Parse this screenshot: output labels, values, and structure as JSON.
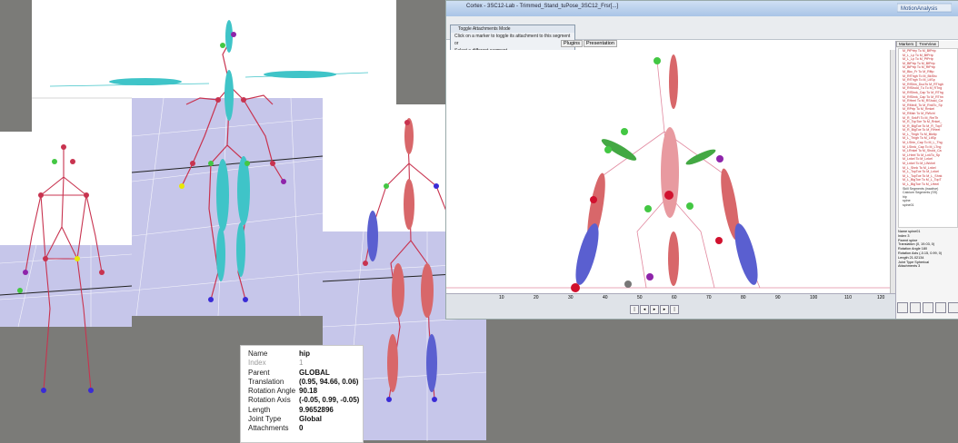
{
  "properties": {
    "rows": [
      {
        "key": "Name",
        "value": "hip"
      },
      {
        "key": "Index",
        "value": "1"
      },
      {
        "key": "Parent",
        "value": "GLOBAL"
      },
      {
        "key": "Translation",
        "value": "(0.95, 94.66, 0.06)"
      },
      {
        "key": "Rotation Angle",
        "value": "90.18"
      },
      {
        "key": "Rotation Axis",
        "value": "(-0.05, 0.99, -0.05)"
      },
      {
        "key": "Length",
        "value": "9.9652896"
      },
      {
        "key": "Joint Type",
        "value": "Global"
      },
      {
        "key": "Attachments",
        "value": "0"
      }
    ]
  },
  "cortex": {
    "title": "Cortex - 3SC12-Lab - Trimmed_Stand_tuPose_3SC12_Frsr[...]",
    "logo": "MotionAnalysis",
    "popup": {
      "title": "Toggle Attachments Mode",
      "line1": "Click on a marker to toggle its attachment to this segment or",
      "line2": "Select a different segment"
    },
    "tabs": [
      "Plugins",
      "Presentation"
    ],
    "ruler": [
      "10",
      "20",
      "30",
      "40",
      "50",
      "60",
      "70",
      "80",
      "90",
      "100",
      "110",
      "120"
    ],
    "right_tabs": [
      "Markers",
      "TreeView"
    ],
    "tree_items": [
      "M_PfPrtry To M_BfPrtp",
      "M_L_Lp To M_BfPrtp",
      "M_L_Lp To M_PfPrtp",
      "M_BfPrtp To M_BfPrtp",
      "M_BfPrtp To M_RfPrtp",
      "M_Bkc_Fr To M_Rfltp",
      "M_RfThgh To M_BkShc",
      "M_RfThgh To M_LtlSp",
      "M_RfShin_DuoTo M_RThgh",
      "M_RfShold_Tu To M_RTng",
      "M_RfShnk_Cap To M_RThg",
      "M_RfShnk_Cap To M_RThn",
      "M_RHeel To M_RShold_Ca",
      "M_RMedl_To M_RnkTo_Sp",
      "M_RPrtp To M_Rmkel",
      "M_RMsh To M_RWchl",
      "M_R_SnkFl To M_RmTh",
      "M_R_TopToe To M_Rnkel_",
      "M_R_BigToe To M_R_TopT",
      "M_R_BigToe To M_RHeel",
      "M_L_Thigh To M_Bkrlip",
      "M_L_Thigh To M_LtlSp",
      "M_LShin_Cap To M_L_Thg",
      "M_LShnk_Cap To M_LTng",
      "M_LRnkel To M_Shold_Ca",
      "M_LHeel To M_LnkTo_Sp",
      "M_Lnkel To M_Lnkel",
      "M_Lnkel To M_LWchel",
      "M_L_Shnk To M_Lnkel",
      "M_L_TopToe To M_Lnkel",
      "M_L_TopToe To M_L_Shnk",
      "M_L_BigToe To M_L_TopT",
      "M_L_BigToe To M_LHeel"
    ],
    "tree_footer": [
      "Skill Segments (inactive)",
      "Calcium Segments (SS)",
      "hip",
      "spine",
      "spine01"
    ],
    "right_props": [
      {
        "key": "Name",
        "value": "spine01"
      },
      {
        "key": "Index",
        "value": "3"
      },
      {
        "key": "Parent",
        "value": "spine"
      },
      {
        "key": "Translation",
        "value": "(0, 19.03, 0)"
      },
      {
        "key": "Rotation Angle",
        "value": "180"
      },
      {
        "key": "Rotation Axis",
        "value": "(-0.15, 0.99, 0)"
      },
      {
        "key": "Length",
        "value": "21.02134"
      },
      {
        "key": "Joint Type",
        "value": "Spherical"
      },
      {
        "key": "Attachments",
        "value": "3"
      }
    ]
  },
  "colors": {
    "segment_cyan": "#3fc4c8",
    "segment_red": "#d8676a",
    "segment_blue": "#5a5fd0",
    "bone_line": "#c8334f",
    "floor": "#c6c6ea"
  }
}
